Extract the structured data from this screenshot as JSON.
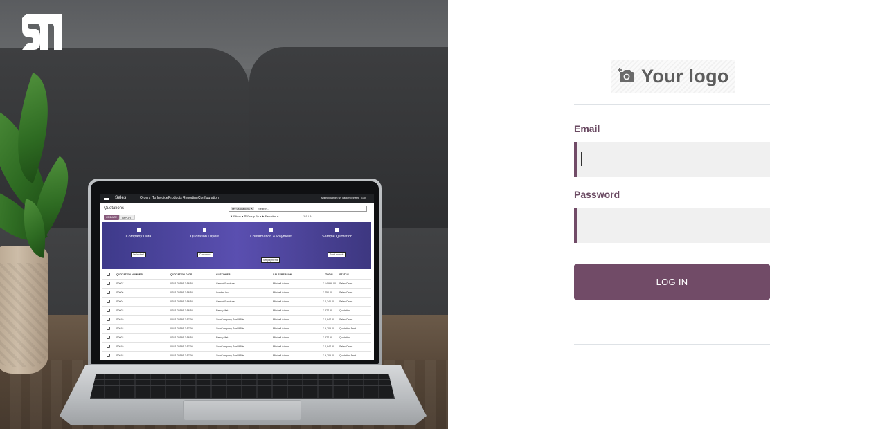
{
  "branding": {
    "logo_icon": "brand-monogram-icon",
    "placeholder_logo_text": "Your logo",
    "placeholder_logo_icon": "add-photo-icon"
  },
  "login_form": {
    "email_label": "Email",
    "email_value": "",
    "password_label": "Password",
    "password_value": "",
    "submit_label": "LOG IN"
  },
  "colors": {
    "primary": "#714b67",
    "label": "#6a4a62",
    "field_bg": "#f0f0f0",
    "divider": "#dee2e6"
  },
  "hero_laptop_screen": {
    "app_name": "Sales",
    "menu": [
      "Orders",
      "To Invoice",
      "Products",
      "Reporting",
      "Configuration"
    ],
    "user": "Mitchell Admin (sh_backend_theme_v13)",
    "page_title": "Quotations",
    "create_label": "CREATE",
    "import_label": "IMPORT",
    "search_facet": "My Quotations ✕",
    "search_placeholder": "Search...",
    "filters": "▼ Filters ▾   ☰ Group By ▾   ★ Favorites ▾",
    "pager": "1-9 / 9",
    "steps": [
      {
        "title": "Company Data",
        "button": "Let's start!"
      },
      {
        "title": "Quotation Layout",
        "button": "Customize"
      },
      {
        "title": "Confirmation & Payment",
        "button": "Set payments"
      },
      {
        "title": "Sample Quotation",
        "button": "Send sample"
      }
    ],
    "columns": [
      "QUOTATION NUMBER",
      "QUOTATION DATE",
      "CUSTOMER",
      "SALESPERSON",
      "TOTAL",
      "STATUS"
    ],
    "rows": [
      [
        "S0007",
        "07/11/2019 17:56:58",
        "Gemini Furniture",
        "Mitchell Admin",
        "£ 14,999.00",
        "Sales Order"
      ],
      [
        "S0006",
        "07/11/2019 17:56:58",
        "Lumber Inc",
        "Mitchell Admin",
        "£ 750.00",
        "Sales Order"
      ],
      [
        "S0004",
        "07/11/2019 17:56:58",
        "Gemini Furniture",
        "Mitchell Admin",
        "£ 2,240.00",
        "Sales Order"
      ],
      [
        "S0003",
        "07/11/2019 17:56:58",
        "Ready Mat",
        "Mitchell Admin",
        "£ 377.50",
        "Quotation"
      ],
      [
        "S0019",
        "06/11/2019 17:57:00",
        "YourCompany, Joel Willis",
        "Mitchell Admin",
        "£ 2,947.50",
        "Sales Order"
      ],
      [
        "S0018",
        "06/11/2019 17:57:00",
        "YourCompany, Joel Willis",
        "Mitchell Admin",
        "£ 9,705.00",
        "Quotation Sent"
      ],
      [
        "S0003",
        "07/11/2019 17:56:58",
        "Ready Mat",
        "Mitchell Admin",
        "£ 377.50",
        "Quotation"
      ],
      [
        "S0019",
        "06/11/2019 17:57:00",
        "YourCompany, Joel Willis",
        "Mitchell Admin",
        "£ 2,947.50",
        "Sales Order"
      ],
      [
        "S0018",
        "06/11/2019 17:57:00",
        "YourCompany, Joel Willis",
        "Mitchell Admin",
        "£ 9,705.00",
        "Quotation Sent"
      ]
    ]
  }
}
